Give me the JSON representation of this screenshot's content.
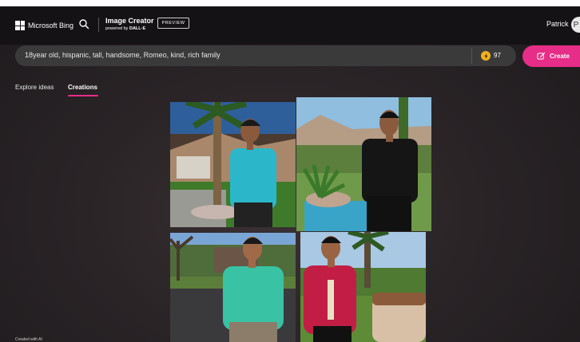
{
  "header": {
    "brand": "Microsoft Bing",
    "product_title": "Image Creator",
    "powered_by_prefix": "powered by",
    "powered_by_name": "DALL·E",
    "badge": "PREVIEW",
    "user_name": "Patrick",
    "avatar_initial": "P"
  },
  "prompt": {
    "value": "18year old, hispanic, tall, handsome, Romeo, kind, rich family",
    "coins": "97",
    "create_label": "Create"
  },
  "tabs": [
    {
      "label": "Explore ideas",
      "active": false
    },
    {
      "label": "Creations",
      "active": true
    }
  ],
  "images": [
    {
      "name": "result-image-1",
      "shirt": "#2bb7c9"
    },
    {
      "name": "result-image-2",
      "shirt": "#151515"
    },
    {
      "name": "result-image-3",
      "shirt": "#39c2a3"
    },
    {
      "name": "result-image-4",
      "shirt": "#c21e45"
    }
  ],
  "footer_note": "Created with AI",
  "colors": {
    "accent": "#e62d87",
    "coin": "#f3b21d",
    "background": "#2a2427",
    "header": "#141214"
  },
  "icons": [
    "microsoft-logo-icon",
    "search-icon",
    "coin-icon",
    "create-icon"
  ]
}
